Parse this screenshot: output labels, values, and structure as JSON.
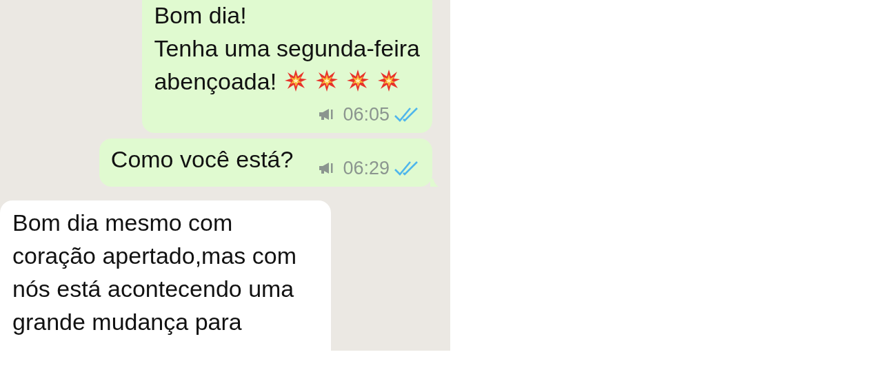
{
  "messages": [
    {
      "kind": "outgoing",
      "text": "Bom dia!\nTenha uma segunda-feira\nabençoada!",
      "trailing_icons": [
        {
          "kind": "burst"
        },
        {
          "kind": "burst"
        },
        {
          "kind": "burst"
        },
        {
          "kind": "burst"
        }
      ],
      "broadcast": true,
      "time": "06:05",
      "read": true,
      "tail": false
    },
    {
      "kind": "outgoing",
      "text": "Como você está?",
      "broadcast": true,
      "time": "06:29",
      "read": true,
      "tail": true
    },
    {
      "kind": "incoming",
      "text": "Bom dia mesmo com\ncoração apertado,mas com\nnós está acontecendo uma\ngrande mudança para",
      "tail": false
    }
  ]
}
